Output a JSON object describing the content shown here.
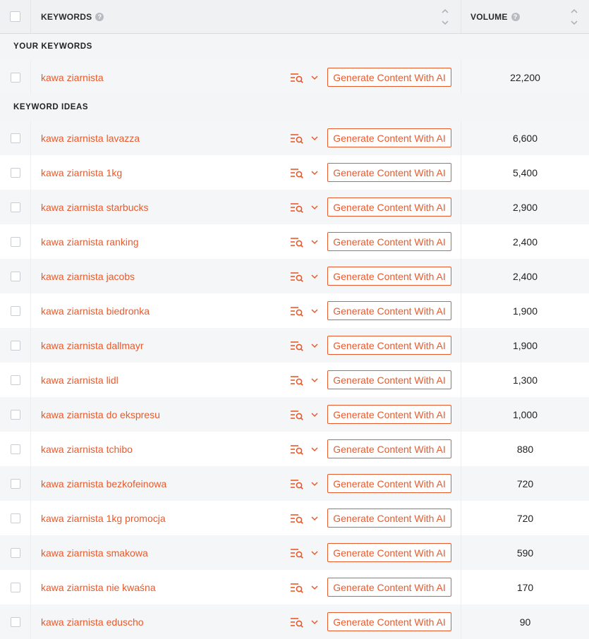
{
  "header": {
    "keywords_label": "KEYWORDS",
    "volume_label": "VOLUME",
    "help_glyph": "?"
  },
  "sections": {
    "your_keywords": "YOUR KEYWORDS",
    "keyword_ideas": "KEYWORD IDEAS"
  },
  "button_label": "Generate Content With AI",
  "accent_color": "#e85a2c",
  "your_keywords": [
    {
      "keyword": "kawa ziarnista",
      "volume": "22,200"
    }
  ],
  "keyword_ideas": [
    {
      "keyword": "kawa ziarnista lavazza",
      "volume": "6,600"
    },
    {
      "keyword": "kawa ziarnista 1kg",
      "volume": "5,400"
    },
    {
      "keyword": "kawa ziarnista starbucks",
      "volume": "2,900"
    },
    {
      "keyword": "kawa ziarnista ranking",
      "volume": "2,400"
    },
    {
      "keyword": "kawa ziarnista jacobs",
      "volume": "2,400"
    },
    {
      "keyword": "kawa ziarnista biedronka",
      "volume": "1,900"
    },
    {
      "keyword": "kawa ziarnista dallmayr",
      "volume": "1,900"
    },
    {
      "keyword": "kawa ziarnista lidl",
      "volume": "1,300"
    },
    {
      "keyword": "kawa ziarnista do ekspresu",
      "volume": "1,000"
    },
    {
      "keyword": "kawa ziarnista tchibo",
      "volume": "880"
    },
    {
      "keyword": "kawa ziarnista bezkofeinowa",
      "volume": "720"
    },
    {
      "keyword": "kawa ziarnista 1kg promocja",
      "volume": "720"
    },
    {
      "keyword": "kawa ziarnista smakowa",
      "volume": "590"
    },
    {
      "keyword": "kawa ziarnista nie kwaśna",
      "volume": "170"
    },
    {
      "keyword": "kawa ziarnista eduscho",
      "volume": "90"
    }
  ]
}
